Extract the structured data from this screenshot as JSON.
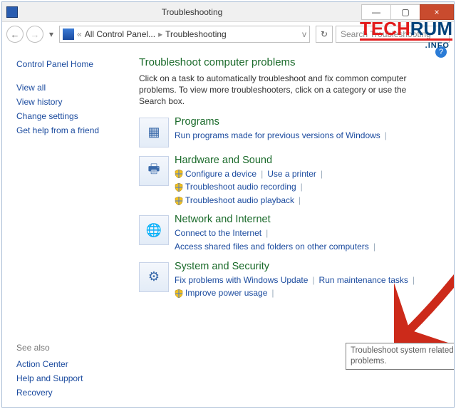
{
  "window": {
    "title": "Troubleshooting",
    "min": "—",
    "max": "▢",
    "close": "×"
  },
  "breadcrumb": {
    "root_dd": "«",
    "item1": "All Control Panel...",
    "item2": "Troubleshooting",
    "sep": "▸",
    "dd": "v"
  },
  "refresh": "↻",
  "search": {
    "placeholder": "Search Troubleshooting"
  },
  "sidebar": {
    "home": "Control Panel Home",
    "links": [
      "View all",
      "View history",
      "Change settings",
      "Get help from a friend"
    ],
    "seealso": "See also",
    "seealso_links": [
      "Action Center",
      "Help and Support",
      "Recovery"
    ]
  },
  "main": {
    "heading": "Troubleshoot computer problems",
    "sub": "Click on a task to automatically troubleshoot and fix common computer problems. To view more troubleshooters, click on a category or use the Search box.",
    "help": "?"
  },
  "cats": [
    {
      "title": "Programs",
      "glyph": "▦",
      "links": [
        {
          "label": "Run programs made for previous versions of Windows",
          "shield": false
        }
      ]
    },
    {
      "title": "Hardware and Sound",
      "glyph": "🖶",
      "links": [
        {
          "label": "Configure a device",
          "shield": true
        },
        {
          "label": "Use a printer",
          "shield": false
        },
        {
          "label": "Troubleshoot audio recording",
          "shield": true
        },
        {
          "label": "Troubleshoot audio playback",
          "shield": true
        }
      ]
    },
    {
      "title": "Network and Internet",
      "glyph": "🌐",
      "links": [
        {
          "label": "Connect to the Internet",
          "shield": false
        },
        {
          "label": "Access shared files and folders on other computers",
          "shield": false
        }
      ]
    },
    {
      "title": "System and Security",
      "glyph": "⚙",
      "links": [
        {
          "label": "Fix problems with Windows Update",
          "shield": false
        },
        {
          "label": "Run maintenance tasks",
          "shield": false
        },
        {
          "label": "Improve power usage",
          "shield": true
        }
      ]
    }
  ],
  "tooltip": "Troubleshoot system related problems.",
  "watermark": {
    "part1": "TECH",
    "part2": "RUM",
    "sub": ".INFO"
  }
}
